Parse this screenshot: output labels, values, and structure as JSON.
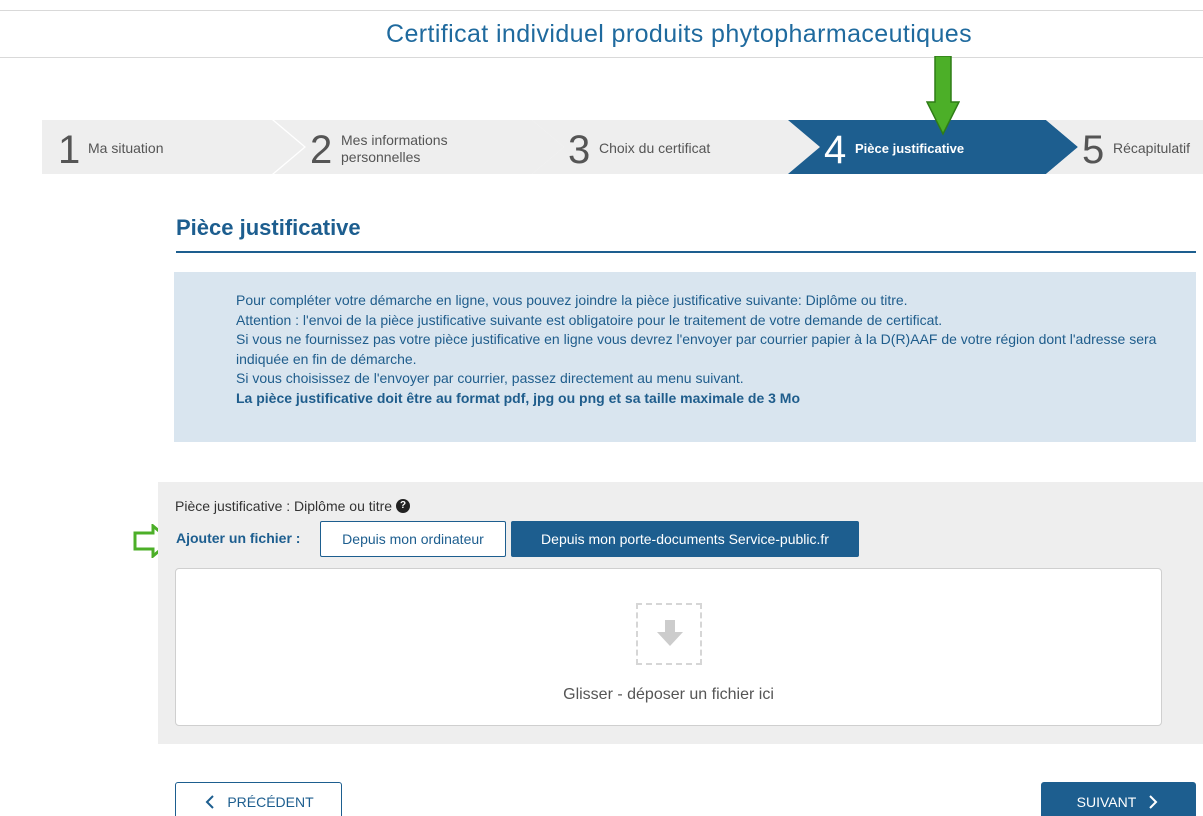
{
  "header": {
    "title": "Certificat individuel produits phytopharmaceutiques"
  },
  "stepper": {
    "steps": [
      {
        "number": "1",
        "label": "Ma situation",
        "state": "inactive"
      },
      {
        "number": "2",
        "label_line1": "Mes informations",
        "label_line2": "personnelles",
        "state": "inactive"
      },
      {
        "number": "3",
        "label": "Choix du certificat",
        "state": "inactive"
      },
      {
        "number": "4",
        "label": "Pièce justificative",
        "state": "active"
      },
      {
        "number": "5",
        "label": "Récapitulatif",
        "state": "inactive"
      }
    ]
  },
  "section": {
    "title": "Pièce justificative"
  },
  "info": {
    "lines": [
      "Pour compléter votre démarche en ligne, vous pouvez joindre la pièce justificative suivante: Diplôme ou titre.",
      "Attention : l'envoi de la pièce justificative suivante est obligatoire pour le traitement de votre demande de certificat.",
      "Si vous ne fournissez pas votre pièce justificative en ligne vous devrez l'envoyer par courrier papier à la D(R)AAF de votre région dont l'adresse sera indiquée en fin de démarche.",
      "Si vous choisissez de l'envoyer par courrier, passez directement au menu suivant."
    ],
    "bold_line": "La pièce justificative doit être au format pdf, jpg ou png et sa taille maximale de 3 Mo"
  },
  "upload": {
    "doc_label": "Pièce justificative : Diplôme ou titre",
    "help_icon": "?",
    "add_label": "Ajouter un fichier :",
    "btn_local": "Depuis mon ordinateur",
    "btn_docs": "Depuis mon porte-documents Service-public.fr",
    "drop_text": "Glisser - déposer un fichier ici"
  },
  "nav": {
    "prev_label": "PRÉCÉDENT",
    "next_label": "SUIVANT"
  },
  "colors": {
    "brand_blue": "#1d5e8f",
    "step_inactive": "#eeeeee",
    "info_bg": "#d9e5ef",
    "annotation_green": "#4caf28"
  },
  "icons": {
    "step_arrow_annotation": "green-down-arrow-icon",
    "add_arrow_annotation": "green-right-arrow-icon",
    "help": "question-circle-icon",
    "drop": "download-arrow-icon",
    "prev": "chevron-left-icon",
    "next": "chevron-right-icon"
  }
}
